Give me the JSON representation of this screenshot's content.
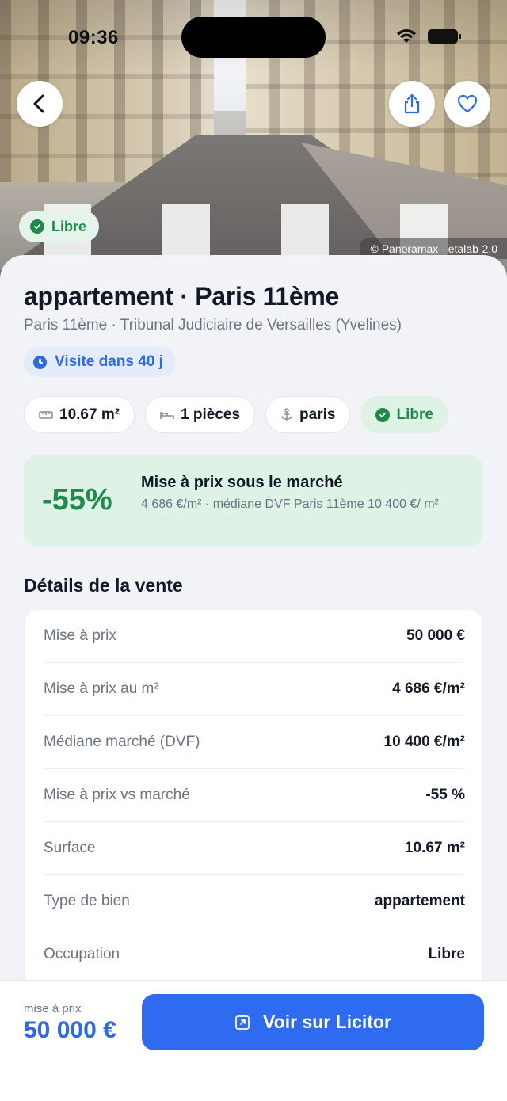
{
  "status_bar": {
    "time": "09:36"
  },
  "hero": {
    "badge_label": "Libre",
    "credit": "© Panoramax · etalab-2.0",
    "icons": {
      "back": "chevron-left-icon",
      "share": "share-icon",
      "favorite": "heart-icon"
    }
  },
  "listing": {
    "title": "appartement · Paris 11ème",
    "subtitle": "Paris 11ème · Tribunal Judiciaire de Versailles (Yvelines)",
    "visit_badge": "Visite dans 40 j"
  },
  "chips": [
    {
      "label": "10.67 m²",
      "icon": "ruler-icon"
    },
    {
      "label": "1 pièces",
      "icon": "bed-icon"
    },
    {
      "label": "paris",
      "icon": "anchor-icon"
    },
    {
      "label": "Libre",
      "icon": "check-circle-icon"
    }
  ],
  "market": {
    "percent": "-55%",
    "title": "Mise à prix sous le marché",
    "text": "4 686 €/m² · médiane DVF Paris 11ème 10 400 €/ m²"
  },
  "details": {
    "title": "Détails de la vente",
    "rows": [
      {
        "label": "Mise à prix",
        "value": "50 000 €"
      },
      {
        "label": "Mise à prix au m²",
        "value": "4 686 €/m²"
      },
      {
        "label": "Médiane marché (DVF)",
        "value": "10 400 €/m²"
      },
      {
        "label": "Mise à prix vs marché",
        "value": "-55 %"
      },
      {
        "label": "Surface",
        "value": "10.67 m²"
      },
      {
        "label": "Type de bien",
        "value": "appartement"
      },
      {
        "label": "Occupation",
        "value": "Libre"
      }
    ]
  },
  "bottom_bar": {
    "price_label": "mise à prix",
    "price_value": "50 000 €",
    "cta_label": "Voir sur Licitor"
  },
  "colors": {
    "accent": "#2f6bf0",
    "green": "#1e8a4c",
    "green_bg": "#dff2e6"
  }
}
